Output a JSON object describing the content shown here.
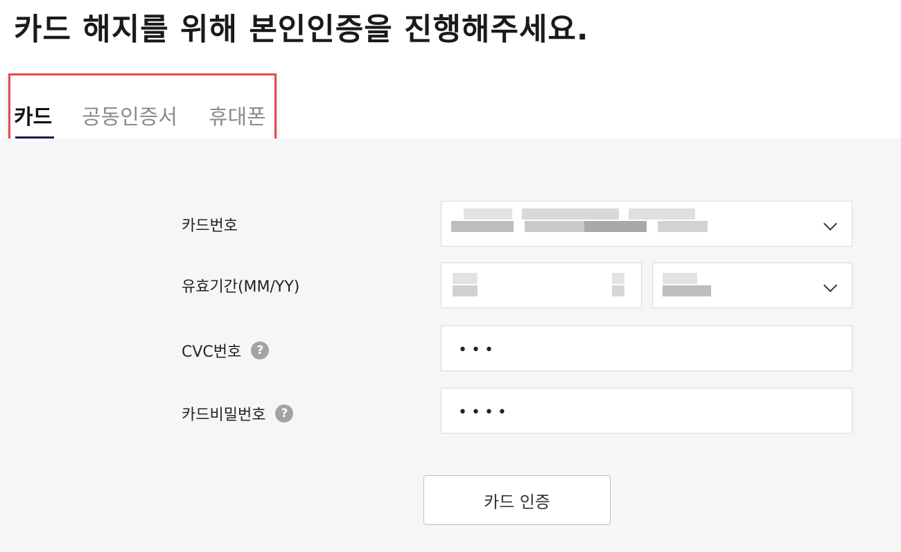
{
  "page": {
    "title": "카드 해지를 위해 본인인증을 진행해주세요."
  },
  "tabs": [
    {
      "label": "카드",
      "active": true
    },
    {
      "label": "공동인증서",
      "active": false
    },
    {
      "label": "휴대폰",
      "active": false
    }
  ],
  "form": {
    "card_number": {
      "label": "카드번호",
      "value_redacted": true,
      "type": "select"
    },
    "expiry": {
      "label": "유효기간(MM/YY)",
      "month_redacted": true,
      "year_redacted": true
    },
    "cvc": {
      "label": "CVC번호",
      "help": "?",
      "value": "•••"
    },
    "card_password": {
      "label": "카드비밀번호",
      "help": "?",
      "value": "••••"
    }
  },
  "submit": {
    "label": "카드 인증"
  },
  "colors": {
    "tab_underline": "#0f1b4c",
    "highlight": "#e8474c",
    "panel_bg": "#f6f6f8",
    "help_icon_bg": "#a3a3a3"
  }
}
